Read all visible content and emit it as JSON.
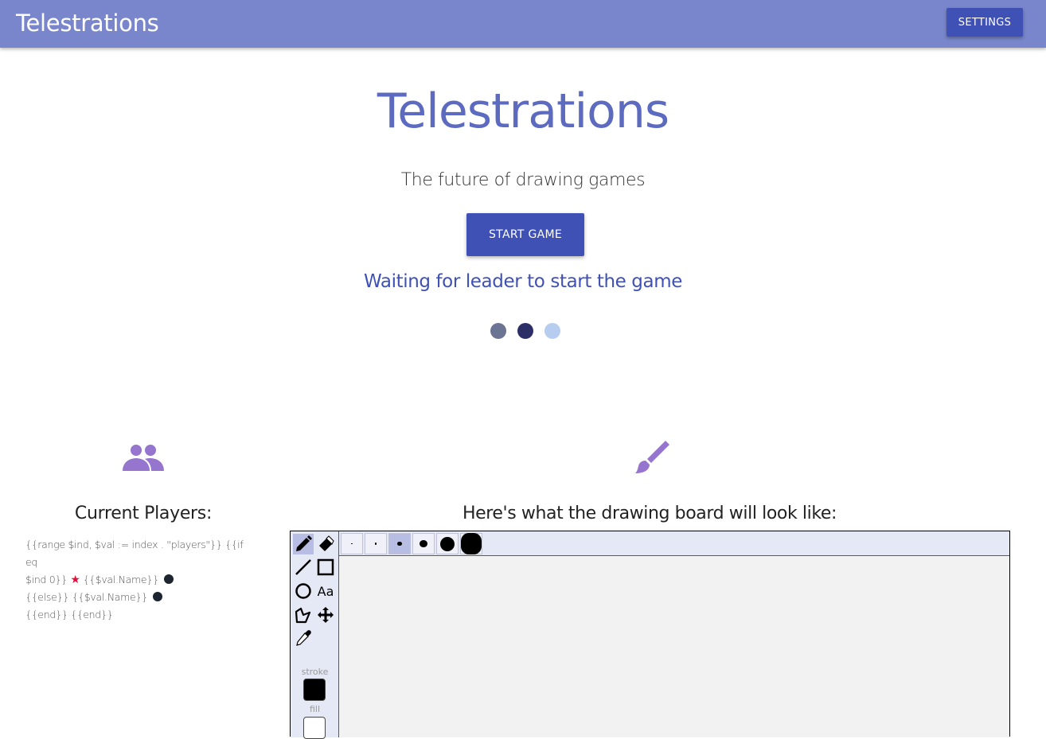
{
  "appbar": {
    "title": "Telestrations",
    "settings_label": "SETTINGS",
    "color": "#7986cb"
  },
  "hero": {
    "title": "Telestrations",
    "subtitle": "The future of drawing games",
    "start_label": "START GAME",
    "waiting_text": "Waiting for leader to start the game",
    "loading_dot_colors": [
      "#6b7593",
      "#2c2f66",
      "#b6cdf0"
    ]
  },
  "players": {
    "icon": "people-icon",
    "heading": "Current Players:",
    "template_line1": "{{range $ind, $val := index . \"players\"}} {{if eq",
    "template_line2a": "$ind 0}}",
    "template_star": "★",
    "template_line2b": "{{$val.Name}}",
    "template_line3": "{{else}} {{$val.Name}}",
    "template_line4": "{{end}} {{end}}",
    "leader_star_color": "#e0103a"
  },
  "board": {
    "icon": "brush-icon",
    "heading": "Here's what the drawing board will look like:",
    "tools": [
      {
        "name": "pencil",
        "icon": "pencil-icon",
        "active": true
      },
      {
        "name": "eraser",
        "icon": "eraser-icon",
        "active": false
      },
      {
        "name": "line",
        "icon": "line-icon",
        "active": false
      },
      {
        "name": "rectangle",
        "icon": "rectangle-icon",
        "active": false
      },
      {
        "name": "ellipse",
        "icon": "ellipse-icon",
        "active": false
      },
      {
        "name": "text",
        "icon": "text-icon",
        "label": "Aa",
        "active": false
      },
      {
        "name": "polygon",
        "icon": "polygon-icon",
        "active": false
      },
      {
        "name": "move",
        "icon": "move-icon",
        "active": false
      },
      {
        "name": "eyedropper",
        "icon": "eyedropper-icon",
        "active": false
      }
    ],
    "stroke_label": "stroke",
    "fill_label": "fill",
    "stroke_color": "#000000",
    "fill_color": "#ffffff",
    "brush_sizes": [
      1,
      2,
      5,
      10,
      20,
      30
    ],
    "active_size_index": 2
  }
}
